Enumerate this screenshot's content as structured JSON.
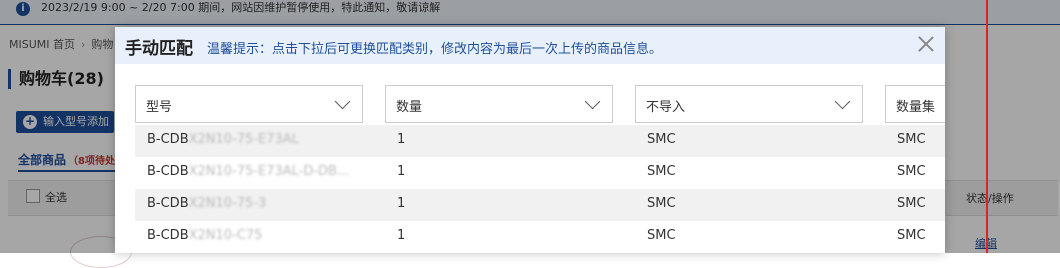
{
  "notice": {
    "text": "2023/2/19 9:00 ~ 2/20 7:00 期间，网站因维护暂停使用，特此通知，敬请谅解"
  },
  "breadcrumb": {
    "home": "MISUMI 首页",
    "current": "购物"
  },
  "cart": {
    "title": "购物车(28)",
    "add_button": "输入型号添加",
    "tab_all": "全部商品",
    "tab_count": "（8项待处",
    "select_all": "全选",
    "status_col": "状态/操作",
    "edit_link": "编辑"
  },
  "modal": {
    "title": "手动匹配",
    "tip": "温馨提示：点击下拉后可更换匹配类别，修改内容为最后一次上传的商品信息。",
    "selects": [
      "型号",
      "数量",
      "不导入",
      "数量集"
    ],
    "rows": [
      {
        "model_prefix": "B-CDB",
        "model_rest": "X2N10-75-E73AL",
        "qty": "1",
        "import": "SMC",
        "col4": "SMC"
      },
      {
        "model_prefix": "B-CDB",
        "model_rest": "X2N10-75-E73AL-D-DB...",
        "qty": "1",
        "import": "SMC",
        "col4": "SMC"
      },
      {
        "model_prefix": "B-CDB",
        "model_rest": "X2N10-75-3",
        "qty": "1",
        "import": "SMC",
        "col4": "SMC"
      },
      {
        "model_prefix": "B-CDB",
        "model_rest": "X2N10-C75",
        "qty": "1",
        "import": "SMC",
        "col4": "SMC"
      }
    ]
  },
  "colors": {
    "accent": "#1f4f9c",
    "alert_line": "#d9252b",
    "tip": "#1f4f9c"
  }
}
